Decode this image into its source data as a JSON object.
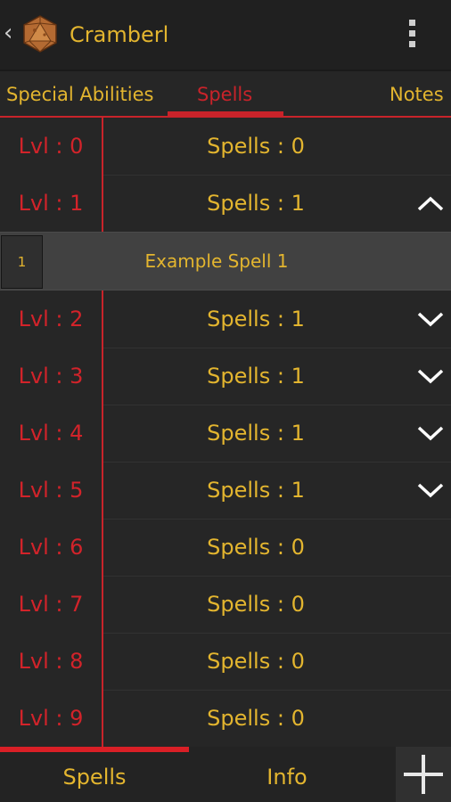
{
  "header": {
    "title": "Cramberl",
    "back_glyph": "‹",
    "icon": "d20-die-icon"
  },
  "tabs": [
    {
      "label": "Special Abilities",
      "active": false
    },
    {
      "label": "Spells",
      "active": true
    },
    {
      "label": "Notes",
      "active": false
    }
  ],
  "levels": [
    {
      "level": "Lvl : 0",
      "spells": "Spells : 0",
      "expandable": false
    },
    {
      "level": "Lvl : 1",
      "spells": "Spells : 1",
      "expandable": true,
      "expanded": true
    },
    {
      "level": "Lvl : 2",
      "spells": "Spells : 1",
      "expandable": true,
      "expanded": false
    },
    {
      "level": "Lvl : 3",
      "spells": "Spells : 1",
      "expandable": true,
      "expanded": false
    },
    {
      "level": "Lvl : 4",
      "spells": "Spells : 1",
      "expandable": true,
      "expanded": false
    },
    {
      "level": "Lvl : 5",
      "spells": "Spells : 1",
      "expandable": true,
      "expanded": false
    },
    {
      "level": "Lvl : 6",
      "spells": "Spells : 0",
      "expandable": false
    },
    {
      "level": "Lvl : 7",
      "spells": "Spells : 0",
      "expandable": false
    },
    {
      "level": "Lvl : 8",
      "spells": "Spells : 0",
      "expandable": false
    },
    {
      "level": "Lvl : 9",
      "spells": "Spells : 0",
      "expandable": false
    }
  ],
  "expanded_spell": {
    "number": "1",
    "name": "Example Spell 1"
  },
  "bottom_tabs": [
    {
      "label": "Spells",
      "active": true
    },
    {
      "label": "Info",
      "active": false
    }
  ],
  "colors": {
    "accent_red": "#c8232a",
    "text_gold": "#e3b52f",
    "background": "#262626"
  }
}
